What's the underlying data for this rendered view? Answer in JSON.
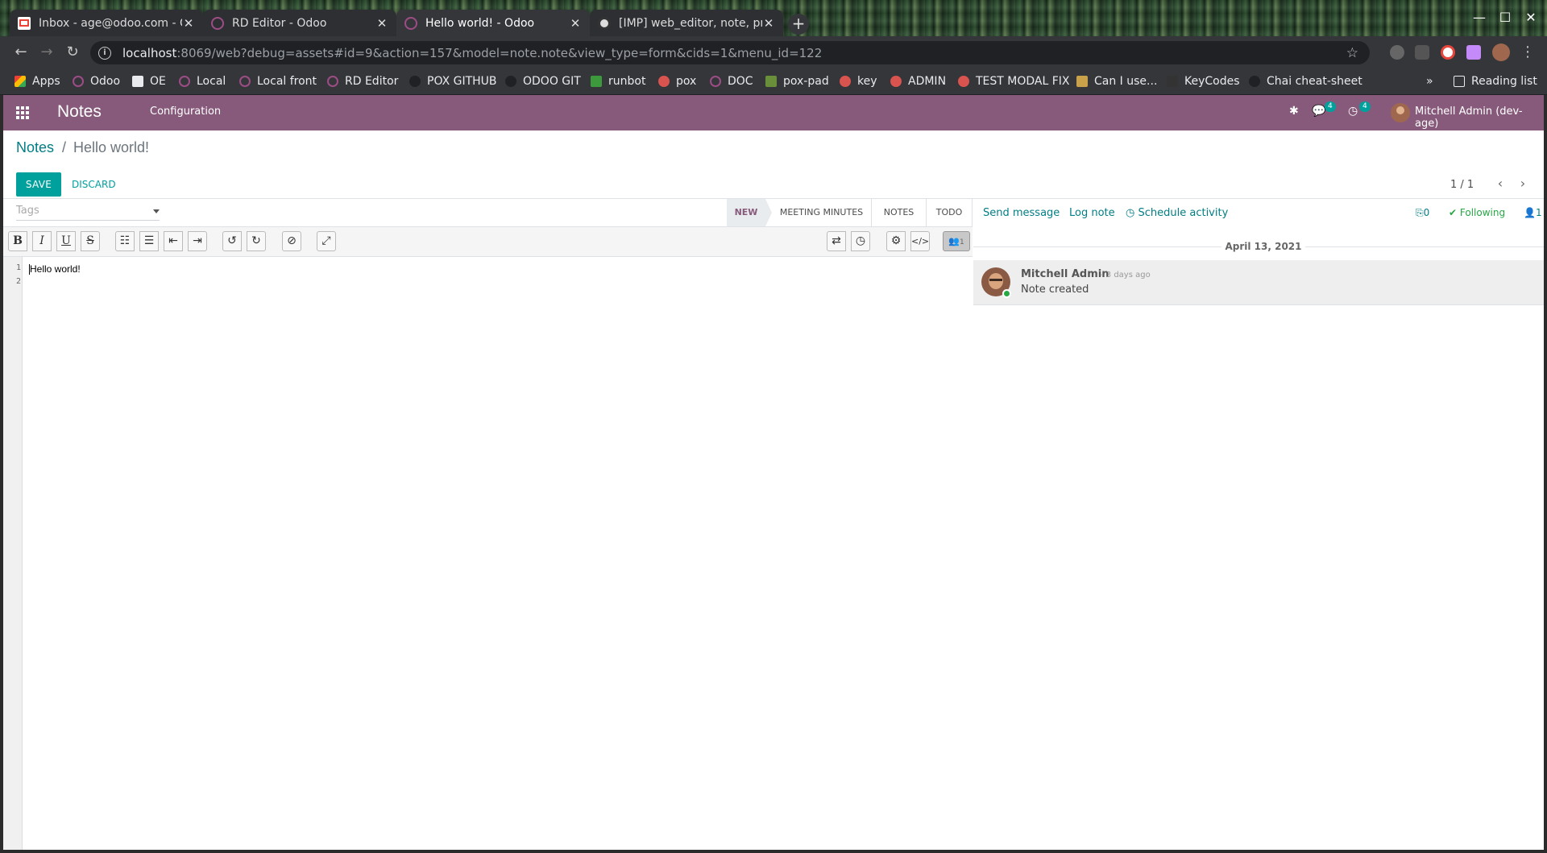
{
  "browser": {
    "tabs": [
      {
        "title": "Inbox - age@odoo.com - Od",
        "color": "#ea4335"
      },
      {
        "title": "RD Editor - Odoo",
        "color": "#9c4d85"
      },
      {
        "title": "Hello world! - Odoo",
        "color": "#9c4d85"
      },
      {
        "title": "[IMP] web_editor, note, pro",
        "color": "#dddddd"
      }
    ],
    "url_host": "localhost",
    "url_rest": ":8069/web?debug=assets#id=9&action=157&model=note.note&view_type=form&cids=1&menu_id=122",
    "bookmarks": [
      "Apps",
      "Odoo",
      "OE",
      "Local",
      "Local front",
      "RD Editor",
      "POX GITHUB",
      "ODOO GIT",
      "runbot",
      "pox",
      "DOC",
      "pox-pad",
      "key",
      "ADMIN",
      "TEST MODAL FIX",
      "Can I use...",
      "KeyCodes",
      "Chai cheat-sheet"
    ],
    "bookmark_overflow": "»",
    "reading_list": "Reading list"
  },
  "navbar": {
    "brand": "Notes",
    "menu_config": "Configuration",
    "messages_badge": "4",
    "activities_badge": "4",
    "user": "Mitchell Admin (dev-age)",
    "color": "#875a7b"
  },
  "control": {
    "breadcrumb_parent": "Notes",
    "breadcrumb_sep": "/",
    "breadcrumb_current": "Hello world!",
    "save": "SAVE",
    "discard": "DISCARD",
    "pager": "1 / 1"
  },
  "form": {
    "tags_placeholder": "Tags",
    "stages": [
      "NEW",
      "MEETING MINUTES",
      "NOTES",
      "TODO"
    ],
    "active_stage": "NEW",
    "collab_count": "1",
    "lines": [
      "1",
      "2"
    ],
    "content": "Hello world!"
  },
  "chatter": {
    "send_message": "Send message",
    "log_note": "Log note",
    "schedule": "Schedule activity",
    "attachments": "0",
    "following": "Following",
    "followers": "1",
    "date": "April 13, 2021",
    "message": {
      "author": "Mitchell Admin",
      "date": "- 3 days ago",
      "body": "Note created"
    }
  },
  "colors": {
    "accent": "#00a09d",
    "link": "#017e84",
    "brand": "#875a7b"
  }
}
